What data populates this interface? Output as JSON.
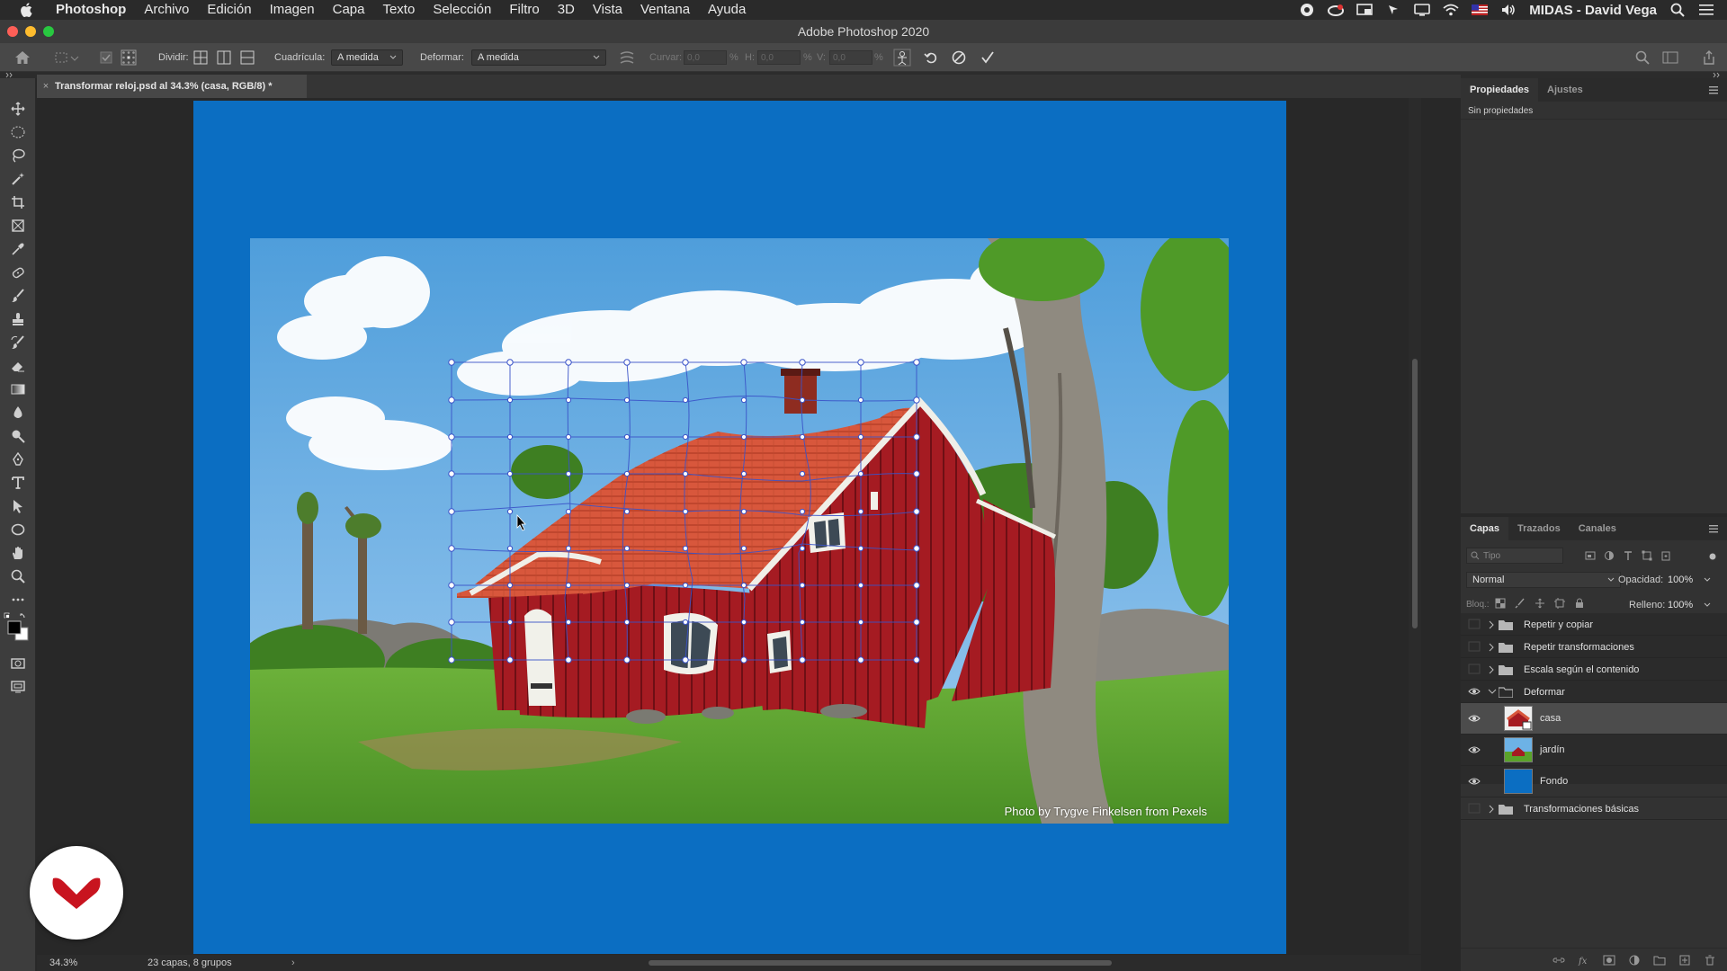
{
  "menubar": {
    "app_name": "Photoshop",
    "items": [
      "Archivo",
      "Edición",
      "Imagen",
      "Capa",
      "Texto",
      "Selección",
      "Filtro",
      "3D",
      "Vista",
      "Ventana",
      "Ayuda"
    ],
    "user": "MIDAS - David Vega"
  },
  "window": {
    "title": "Adobe Photoshop 2020"
  },
  "options": {
    "split_label": "Dividir:",
    "grid_label": "Cuadrícula:",
    "grid_value": "A medida",
    "warp_label": "Deformar:",
    "warp_value": "A medida",
    "bend_label": "Curvar:",
    "bend_value": "0,0",
    "h_label": "H:",
    "h_value": "0,0",
    "v_label": "V:",
    "v_value": "0,0",
    "percent": "%"
  },
  "document": {
    "tab_title": "Transformar reloj.psd al 34.3% (casa, RGB/8) *",
    "photo_credit": "Photo by Trygve Finkelsen from Pexels"
  },
  "status": {
    "zoom": "34.3%",
    "info": "23 capas, 8 grupos"
  },
  "properties_panel": {
    "tabs": [
      "Propiedades",
      "Ajustes"
    ],
    "active_tab": "Propiedades",
    "empty_text": "Sin propiedades"
  },
  "layers_panel": {
    "tabs": [
      "Capas",
      "Trazados",
      "Canales"
    ],
    "active_tab": "Capas",
    "filter_placeholder": "Tipo",
    "blend_mode": "Normal",
    "opacity_label": "Opacidad:",
    "opacity_value": "100%",
    "lock_label": "Bloq.:",
    "fill_label": "Relleno:",
    "fill_value": "100%",
    "layers": [
      {
        "name": "Repetir y copiar",
        "type": "group",
        "visible": false,
        "expanded": false
      },
      {
        "name": "Repetir transformaciones",
        "type": "group",
        "visible": false,
        "expanded": false
      },
      {
        "name": "Escala según el contenido",
        "type": "group",
        "visible": false,
        "expanded": false
      },
      {
        "name": "Deformar",
        "type": "group",
        "visible": true,
        "expanded": true
      },
      {
        "name": "casa",
        "type": "layer",
        "visible": true,
        "selected": true
      },
      {
        "name": "jardín",
        "type": "layer",
        "visible": true
      },
      {
        "name": "Fondo",
        "type": "layer",
        "visible": true
      },
      {
        "name": "Transformaciones básicas",
        "type": "group",
        "visible": false,
        "expanded": false
      }
    ]
  },
  "colors": {
    "artboard": "#0b6ec2",
    "house_red": "#b01c22",
    "roof": "#d9583d",
    "sky": "#6db2e6",
    "grass": "#5aa32a"
  }
}
